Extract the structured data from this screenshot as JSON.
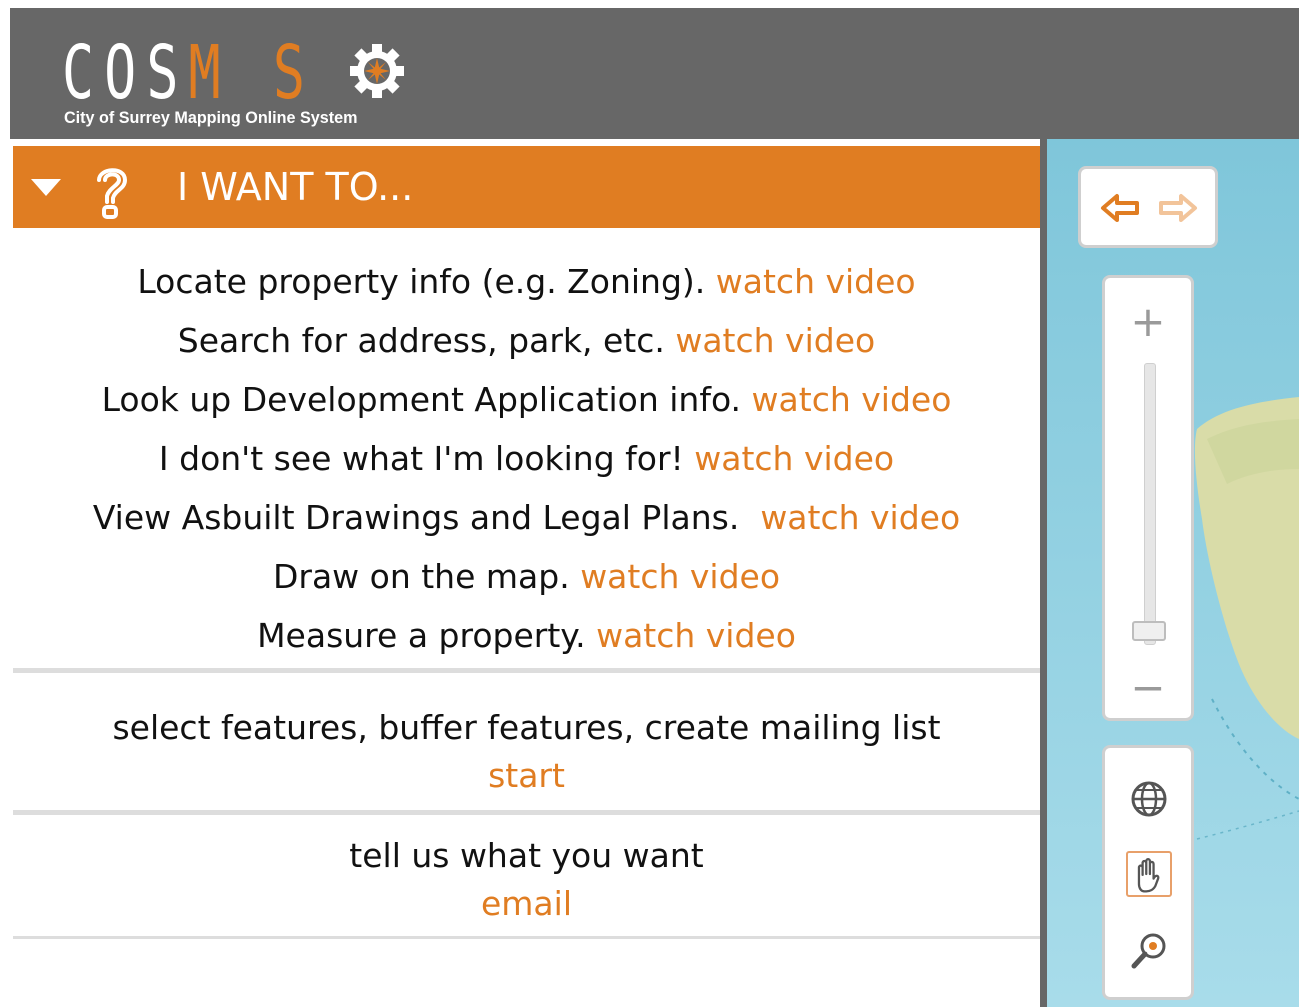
{
  "header": {
    "logo_letters": [
      "C",
      "O",
      "S",
      "M",
      "O",
      "S"
    ],
    "logo_subtitle": "City of Surrey Mapping Online System"
  },
  "panel": {
    "title": "I WANT TO...",
    "items": [
      {
        "text": "Locate property info (e.g. Zoning). ",
        "link": "watch video"
      },
      {
        "text": "Search for address, park, etc. ",
        "link": "watch video"
      },
      {
        "text": "Look up Development Application info. ",
        "link": "watch video"
      },
      {
        "text": "I don't see what I'm looking for! ",
        "link": "watch video"
      },
      {
        "text": "View Asbuilt Drawings and Legal Plans.  ",
        "link": "watch video"
      },
      {
        "text": "Draw on the map. ",
        "link": "watch video"
      },
      {
        "text": "Measure a property. ",
        "link": "watch video"
      }
    ],
    "select_block": {
      "text": "select features, buffer features, create mailing list",
      "link": "start"
    },
    "feedback_block": {
      "text": "tell us what you want",
      "link": "email"
    }
  },
  "map_controls": {
    "nav_icons": [
      "back-arrow-icon",
      "forward-arrow-icon"
    ],
    "zoom_in": "+",
    "zoom_out": "−",
    "tools": [
      "globe-icon",
      "hand-pan-icon",
      "zoom-magnifier-icon"
    ]
  },
  "colors": {
    "accent": "#e07d22",
    "header_bg": "#676767",
    "map_water": "#9fd8e6",
    "map_land": "#d9dca8"
  }
}
